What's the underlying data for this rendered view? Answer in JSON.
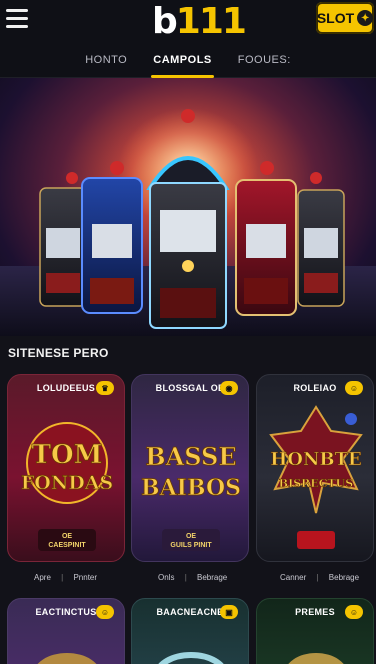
{
  "header": {
    "logo_main": "b",
    "logo_num": "111",
    "slot_label": "SLOT",
    "slot_icon": "chip-icon"
  },
  "tabs": [
    {
      "label": "HONTO"
    },
    {
      "label": "CAMPOLS"
    },
    {
      "label": "FOOUES:"
    }
  ],
  "section": {
    "title": "SITENESE PERO"
  },
  "cards": [
    {
      "title": "LOLUDEEUS",
      "art_line1": "TOM",
      "art_line2": "FONDAS",
      "sub1": "OE",
      "sub2": "CAESPINIT"
    },
    {
      "title": "BLOSSGAL OE",
      "art_line1": "BASSE",
      "art_line2": "BAIBOS",
      "sub1": "OE",
      "sub2": "GUILS PINIT"
    },
    {
      "title": "ROLEIAO",
      "art_line1": "HONBTE",
      "art_line2": "BISRECTUS",
      "sub1": "",
      "sub2": ""
    },
    {
      "title": "EACTINCTUS",
      "art_line1": "",
      "art_line2": "",
      "sub1": "",
      "sub2": ""
    },
    {
      "title": "BAACNEACNE",
      "art_line1": "",
      "art_line2": "",
      "sub1": "",
      "sub2": ""
    },
    {
      "title": "PREMES",
      "art_line1": "",
      "art_line2": "",
      "sub1": "",
      "sub2": ""
    }
  ],
  "meta": [
    {
      "left": "Apre",
      "right": "Pnnter"
    },
    {
      "left": "Onls",
      "right": "Bebrage"
    },
    {
      "left": "Canner",
      "right": "Bebrage"
    }
  ],
  "colors": {
    "accent": "#f5c400",
    "background": "#121219"
  }
}
